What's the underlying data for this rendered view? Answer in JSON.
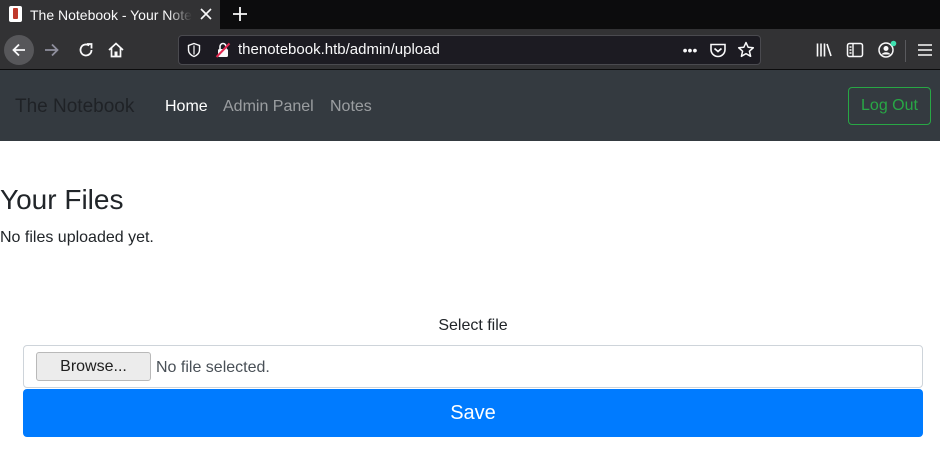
{
  "browser": {
    "tab_title": "The Notebook - Your Notebook",
    "url": "thenotebook.htb/admin/upload",
    "page_actions_label": "•••",
    "icons": [
      "back-arrow-icon",
      "forward-arrow-icon",
      "reload-icon",
      "home-icon",
      "shield-icon",
      "insecure-lock-icon",
      "more-icon",
      "pocket-icon",
      "bookmark-star-icon",
      "library-icon",
      "sidebar-icon",
      "account-icon",
      "menu-icon",
      "close-icon",
      "plus-icon"
    ]
  },
  "site": {
    "brand": "The Notebook",
    "nav": [
      {
        "label": "Home",
        "active": true
      },
      {
        "label": "Admin Panel",
        "active": false
      },
      {
        "label": "Notes",
        "active": false
      }
    ],
    "logout_label": "Log Out",
    "accent_colors": {
      "navbar": "#343a40",
      "logout": "#28a745",
      "save": "#007bff"
    }
  },
  "content": {
    "heading": "Your Files",
    "empty_message": "No files uploaded yet.",
    "upload": {
      "label": "Select file",
      "browse_label": "Browse...",
      "file_status": "No file selected.",
      "save_label": "Save"
    }
  }
}
